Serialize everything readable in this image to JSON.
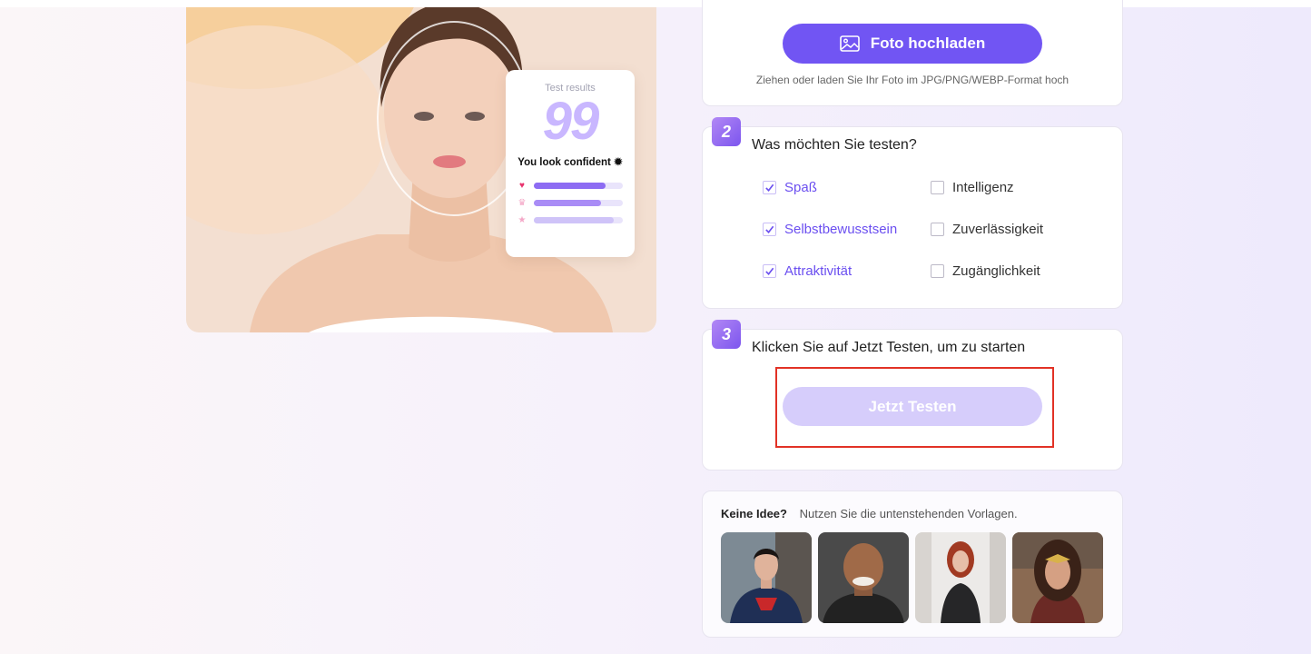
{
  "hero": {
    "result_card": {
      "title": "Test results",
      "score": "99",
      "message": "You look confident",
      "bars": [
        {
          "icon": "heart-icon",
          "level": 0.9
        },
        {
          "icon": "crown-icon",
          "level": 0.84
        },
        {
          "icon": "star-icon",
          "level": 1.0
        }
      ]
    }
  },
  "upload": {
    "button_label": "Foto hochladen",
    "hint": "Ziehen oder laden Sie Ihr Foto im JPG/PNG/WEBP-Format hoch"
  },
  "step2": {
    "number": "2",
    "title": "Was möchten Sie testen?",
    "options": [
      {
        "label": "Spaß",
        "checked": true
      },
      {
        "label": "Intelligenz",
        "checked": false
      },
      {
        "label": "Selbstbewusstsein",
        "checked": true
      },
      {
        "label": "Zuverlässigkeit",
        "checked": false
      },
      {
        "label": "Attraktivität",
        "checked": true
      },
      {
        "label": "Zugänglichkeit",
        "checked": false
      }
    ]
  },
  "step3": {
    "number": "3",
    "title": "Klicken Sie auf Jetzt Testen, um zu starten",
    "button_label": "Jetzt Testen"
  },
  "templates": {
    "lead": "Keine Idee?",
    "text": "Nutzen Sie die untenstehenden Vorlagen.",
    "items": [
      {
        "name": "template-superman"
      },
      {
        "name": "template-bald-man"
      },
      {
        "name": "template-red-hair-woman"
      },
      {
        "name": "template-warrior-woman"
      }
    ]
  },
  "colors": {
    "accent": "#7155f3",
    "accent_light": "#d6cdfb",
    "highlight": "#e23226"
  }
}
